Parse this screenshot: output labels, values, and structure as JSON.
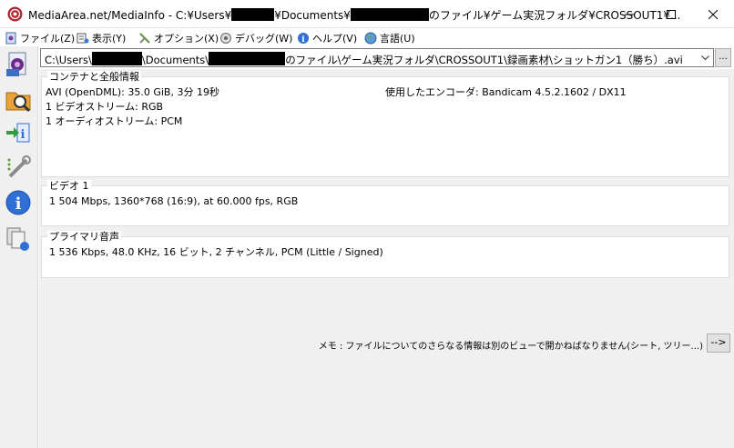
{
  "window": {
    "title_prefix": "MediaArea.net/MediaInfo - C:¥Users¥",
    "title_mid": "¥Documents¥",
    "title_suffix": "のファイル¥ゲーム実況フォルダ¥CROSSOUT1¥..."
  },
  "menu": [
    {
      "label": "ファイル(Z)",
      "icon": "file-icon"
    },
    {
      "label": "表示(Y)",
      "icon": "view-icon"
    },
    {
      "label": "オプション(X)",
      "icon": "options-icon"
    },
    {
      "label": "デバッグ(W)",
      "icon": "debug-icon"
    },
    {
      "label": "ヘルプ(V)",
      "icon": "help-icon"
    },
    {
      "label": "言語(U)",
      "icon": "language-icon"
    }
  ],
  "sidebar": [
    "open-file-icon",
    "open-folder-icon",
    "export-icon",
    "preferences-icon",
    "about-icon",
    "file-list-icon"
  ],
  "path": {
    "prefix": "C:\\Users\\",
    "mid": "\\Documents\\",
    "suffix": "のファイル\\ゲーム実況フォルダ\\CROSSOUT1\\録画素材\\ショットガン1（勝ち）.avi",
    "browse_label": "..."
  },
  "general": {
    "title": "コンテナと全般情報",
    "format": "AVI (OpenDML): 35.0 GiB, 3分 19秒",
    "encoder": "使用したエンコーダ: Bandicam 4.5.2.1602 / DX11",
    "video_streams": "1 ビデオストリーム: RGB",
    "audio_streams": "1 オーディオストリーム: PCM"
  },
  "video": {
    "title": "ビデオ 1",
    "line": "1 504 Mbps, 1360*768 (16:9), at 60.000 fps, RGB"
  },
  "audio": {
    "title": "プライマリ音声",
    "line": "1 536 Kbps, 48.0 KHz, 16 ビット, 2 チャンネル, PCM (Little / Signed)"
  },
  "note": {
    "text": "メモ : ファイルについてのさらなる情報は別のビューで開かねばなりません(シート, ツリー...)",
    "button": "-->"
  }
}
